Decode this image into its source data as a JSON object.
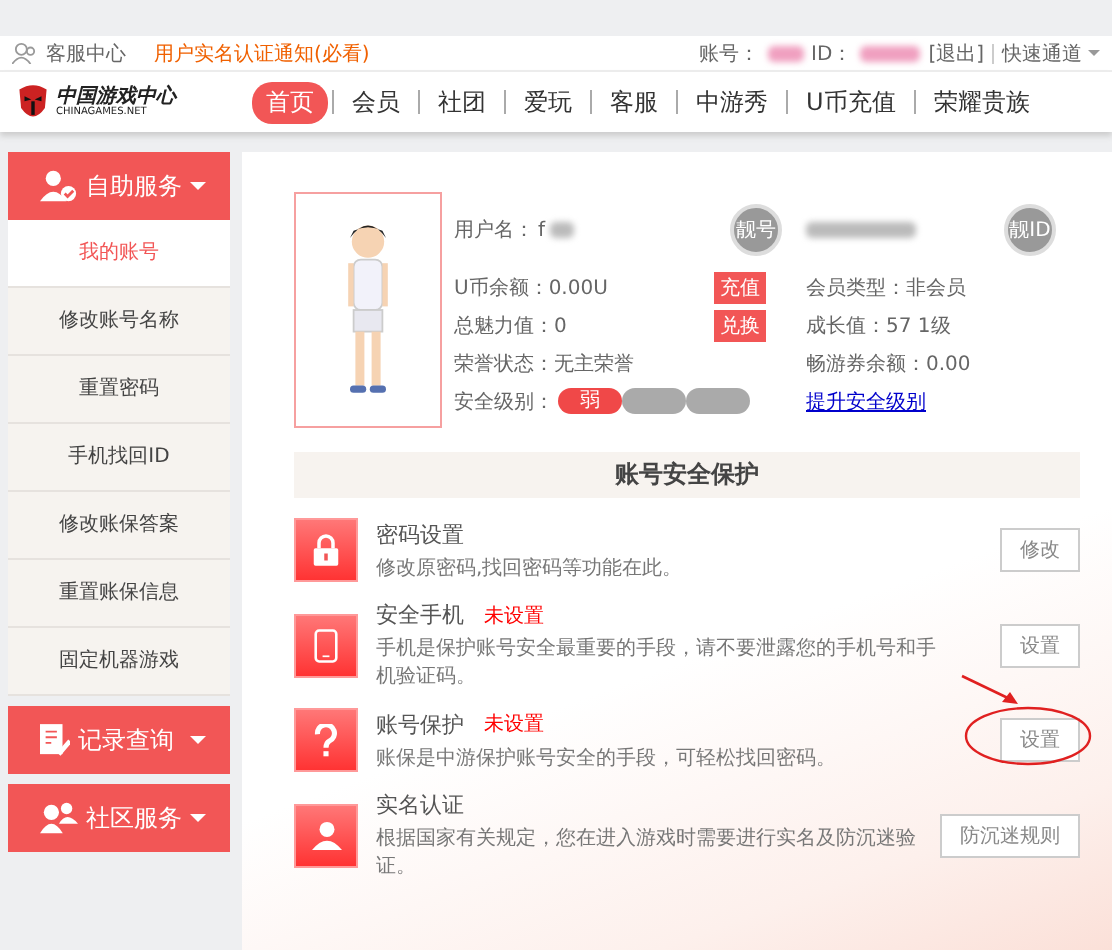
{
  "topbar": {
    "left_link": "客服中心",
    "notice": "用户实名认证通知(必看)",
    "account_label": "账号：",
    "id_label": "ID：",
    "logout": "[退出]",
    "quick_menu": "快速通道"
  },
  "logo": {
    "name": "中国游戏中心",
    "domain": "CHINAGAMES.NET"
  },
  "nav": [
    {
      "label": "首页",
      "selected": true
    },
    {
      "label": "会员",
      "selected": false
    },
    {
      "label": "社团",
      "selected": false
    },
    {
      "label": "爱玩",
      "selected": false
    },
    {
      "label": "客服",
      "selected": false
    },
    {
      "label": "中游秀",
      "selected": false
    },
    {
      "label": "U币充值",
      "selected": false
    },
    {
      "label": "荣耀贵族",
      "selected": false
    }
  ],
  "sidebar": [
    {
      "title": "自助服务",
      "kind": "user",
      "items": [
        {
          "label": "我的账号",
          "selected": true
        },
        {
          "label": "修改账号名称",
          "selected": false
        },
        {
          "label": "重置密码",
          "selected": false
        },
        {
          "label": "手机找回ID",
          "selected": false
        },
        {
          "label": "修改账保答案",
          "selected": false
        },
        {
          "label": "重置账保信息",
          "selected": false
        },
        {
          "label": "固定机器游戏",
          "selected": false
        }
      ]
    },
    {
      "title": "记录查询",
      "kind": "record"
    },
    {
      "title": "社区服务",
      "kind": "group"
    }
  ],
  "profile": {
    "username_label": "用户名：",
    "username_value": "f",
    "badge_left": "靓号",
    "badge_right": "靓ID",
    "left_rows": [
      {
        "label": "U币余额：",
        "value": "0.00U",
        "button": "充值"
      },
      {
        "label": "总魅力值：",
        "value": "0",
        "button": "兑换"
      },
      {
        "label": "荣誉状态：",
        "value": "无主荣誉"
      }
    ],
    "right_rows": [
      {
        "label": "会员类型：",
        "value": "非会员"
      },
      {
        "label": "成长值：",
        "value": "57  1级"
      },
      {
        "label": "畅游券余额：",
        "value": "0.00"
      }
    ],
    "security_label": "安全级别：",
    "security_level": [
      {
        "label": "弱",
        "active": true
      },
      {
        "active": false
      },
      {
        "active": false
      }
    ],
    "upgrade_link": "提升安全级别"
  },
  "security_section": {
    "title": "账号安全保护",
    "items": [
      {
        "kind": "lock",
        "title": "密码设置",
        "desc": "修改原密码,找回密码等功能在此。",
        "button": "修改",
        "annotated": false
      },
      {
        "kind": "phone",
        "title": "安全手机",
        "flag": "未设置",
        "desc": "手机是保护账号安全最重要的手段，请不要泄露您的手机号和手机验证码。",
        "button": "设置",
        "annotated": false
      },
      {
        "kind": "question",
        "title": "账号保护",
        "flag": "未设置",
        "desc": "账保是中游保护账号安全的手段，可轻松找回密码。",
        "button": "设置",
        "annotated": true
      },
      {
        "kind": "person",
        "title": "实名认证",
        "desc": "根据国家有关规定，您在进入游戏时需要进行实名及防沉迷验证。",
        "button": "防沉迷规则",
        "annotated": false
      }
    ]
  }
}
